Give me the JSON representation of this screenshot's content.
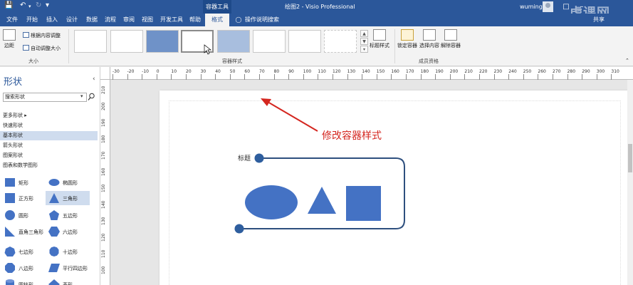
{
  "titlebar": {
    "context_tools": "容器工具",
    "doc_title": "绘图2 - Visio Professional",
    "user": "wuming",
    "watermark": "虎课网"
  },
  "tabs": {
    "items": [
      "文件",
      "开始",
      "插入",
      "设计",
      "数据",
      "流程",
      "审阅",
      "视图",
      "开发工具",
      "帮助",
      "格式"
    ],
    "active": "格式",
    "tell_me": "操作说明搜索",
    "share": "共享"
  },
  "ribbon": {
    "size_group": {
      "margins": "边距",
      "fit_contents": "根据内容调整",
      "auto_size": "自动调整大小",
      "label": "大小"
    },
    "styles_group": {
      "label": "容器样式",
      "heading_style": "标题样式"
    },
    "membership_group": {
      "lock": "锁定容器",
      "select": "选择内容",
      "disband": "解除容器",
      "label": "成员资格"
    }
  },
  "shapes_panel": {
    "title": "形状",
    "search_placeholder": "搜索形状",
    "categories": [
      "更多形状",
      "快速形状",
      "基本形状",
      "箭头形状",
      "图案形状",
      "图表和数学图形"
    ],
    "selected_category": "基本形状",
    "shapes": [
      {
        "label": "矩形",
        "icon": "rectangle-icon"
      },
      {
        "label": "椭圆形",
        "icon": "ellipse-icon"
      },
      {
        "label": "正方形",
        "icon": "square-icon"
      },
      {
        "label": "三角形",
        "icon": "triangle-icon"
      },
      {
        "label": "圆形",
        "icon": "circle-icon"
      },
      {
        "label": "五边形",
        "icon": "pentagon-icon"
      },
      {
        "label": "直角三角形",
        "icon": "right-triangle-icon"
      },
      {
        "label": "六边形",
        "icon": "hexagon-icon"
      },
      {
        "label": "七边形",
        "icon": "heptagon-icon"
      },
      {
        "label": "十边形",
        "icon": "decagon-icon"
      },
      {
        "label": "八边形",
        "icon": "octagon-icon"
      },
      {
        "label": "平行四边形",
        "icon": "parallelogram-icon"
      },
      {
        "label": "圆柱形",
        "icon": "cylinder-icon"
      },
      {
        "label": "菱形",
        "icon": "diamond-icon"
      }
    ]
  },
  "ruler": {
    "top_labels": [
      "-30",
      "-20",
      "-10",
      "0",
      "10",
      "20",
      "30",
      "40",
      "50",
      "60",
      "70",
      "80",
      "90",
      "100",
      "110",
      "120",
      "130",
      "140",
      "150",
      "160",
      "170",
      "180",
      "190",
      "200",
      "210",
      "220",
      "230",
      "240",
      "250",
      "260",
      "270",
      "280",
      "290",
      "300",
      "310"
    ],
    "left_labels": [
      "210",
      "200",
      "190",
      "180",
      "170",
      "160",
      "150",
      "140",
      "130",
      "120",
      "110",
      "100"
    ]
  },
  "canvas": {
    "annotation": "修改容器样式",
    "container_title": "标题",
    "annotation_color": "#d4261f",
    "shape_color": "#4472c4",
    "container_color": "#2e4f7e"
  }
}
